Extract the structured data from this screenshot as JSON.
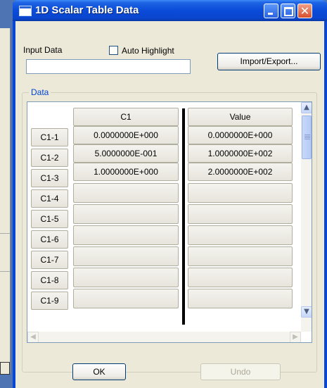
{
  "window": {
    "title": "1D Scalar Table Data"
  },
  "controls": {
    "input_label": "Input Data",
    "input_value": "",
    "auto_highlight_label": "Auto Highlight",
    "auto_highlight_checked": false,
    "import_export_label": "Import/Export..."
  },
  "group": {
    "title": "Data"
  },
  "table": {
    "columns": [
      "C1",
      "Value"
    ],
    "rows": [
      {
        "label": "C1-1",
        "c1": "0.0000000E+000",
        "value": "0.0000000E+000"
      },
      {
        "label": "C1-2",
        "c1": "5.0000000E-001",
        "value": "1.0000000E+002"
      },
      {
        "label": "C1-3",
        "c1": "1.0000000E+000",
        "value": "2.0000000E+002"
      },
      {
        "label": "C1-4",
        "c1": "",
        "value": ""
      },
      {
        "label": "C1-5",
        "c1": "",
        "value": ""
      },
      {
        "label": "C1-6",
        "c1": "",
        "value": ""
      },
      {
        "label": "C1-7",
        "c1": "",
        "value": ""
      },
      {
        "label": "C1-8",
        "c1": "",
        "value": ""
      },
      {
        "label": "C1-9",
        "c1": "",
        "value": ""
      }
    ]
  },
  "buttons": {
    "ok": "OK",
    "undo": "Undo"
  },
  "colors": {
    "titlebar": "#0a46d6",
    "dialog": "#ece9d8",
    "group_title": "#0046d5"
  }
}
